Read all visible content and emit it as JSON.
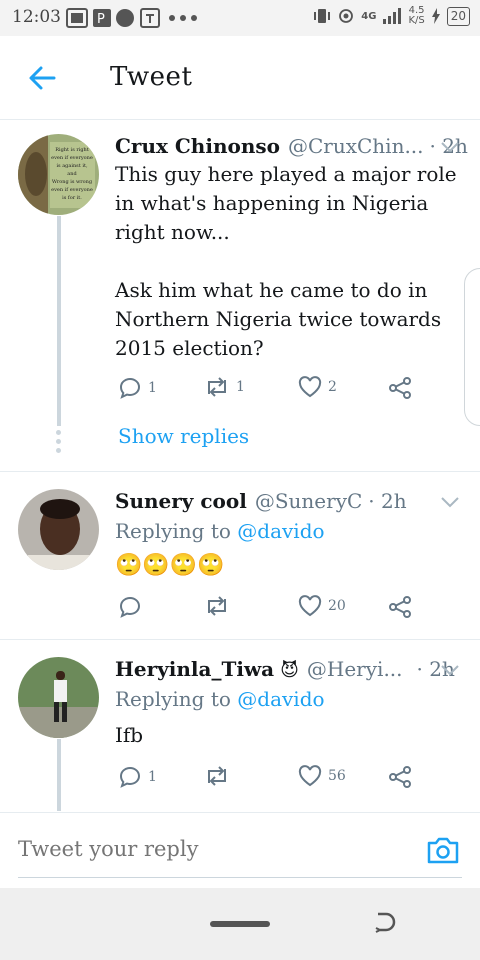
{
  "status_bar": {
    "time": "12:03",
    "network_speed_value": "4.5",
    "network_speed_unit": "K/S",
    "network_type": "4G",
    "battery": "20"
  },
  "header": {
    "title": "Tweet"
  },
  "tweets": [
    {
      "name": "Crux Chinonso",
      "handle": "@CruxChin...",
      "time": "· 2h",
      "avatar_text_lines": [
        "Right is right",
        "even if everyone",
        "is against it,",
        "and",
        "Wrong is wrong",
        "even if everyone",
        "is for it."
      ],
      "body": "This guy here played a major role in what's happening in Nigeria right now...\n\nAsk him what he came to do in Northern Nigeria twice towards 2015 election?",
      "replies": "1",
      "retweets": "1",
      "likes": "2",
      "show_replies": "Show replies"
    },
    {
      "name": "Sunery cool",
      "handle": "@SuneryC",
      "time": "· 2h",
      "replying_label": "Replying to",
      "replying_to": "@davido",
      "body": "🙄🙄🙄🙄",
      "replies": "",
      "retweets": "",
      "likes": "20"
    },
    {
      "name": "Heryinla_Tiwa",
      "name_emoji": "😈",
      "handle": "@Heryi...",
      "time": "· 2h",
      "replying_label": "Replying to",
      "replying_to": "@davido",
      "body": "Ifb",
      "replies": "1",
      "retweets": "",
      "likes": "56"
    }
  ],
  "composer": {
    "placeholder": "Tweet your reply"
  },
  "colors": {
    "accent": "#1da1f2",
    "text": "#14171a",
    "muted": "#657786",
    "divider": "#e6ecf0"
  }
}
